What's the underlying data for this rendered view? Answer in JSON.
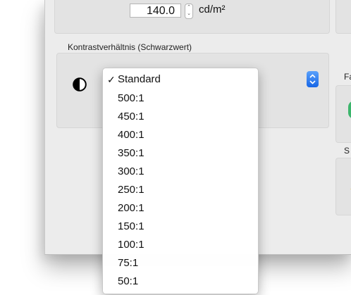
{
  "luminance": {
    "value": "140.0",
    "unit": "cd/m²"
  },
  "contrast": {
    "section_label": "Kontrastverhältnis (Schwarzwert)",
    "selected": "Standard",
    "options": [
      "Standard",
      "500:1",
      "450:1",
      "400:1",
      "350:1",
      "300:1",
      "250:1",
      "200:1",
      "150:1",
      "100:1",
      "75:1",
      "50:1"
    ]
  },
  "right_labels": {
    "first": "Fa",
    "second": "S"
  },
  "icons": {
    "contrast": "contrast-half-circle-icon",
    "popup": "chevron-up-down-icon",
    "check": "checkmark-icon"
  }
}
